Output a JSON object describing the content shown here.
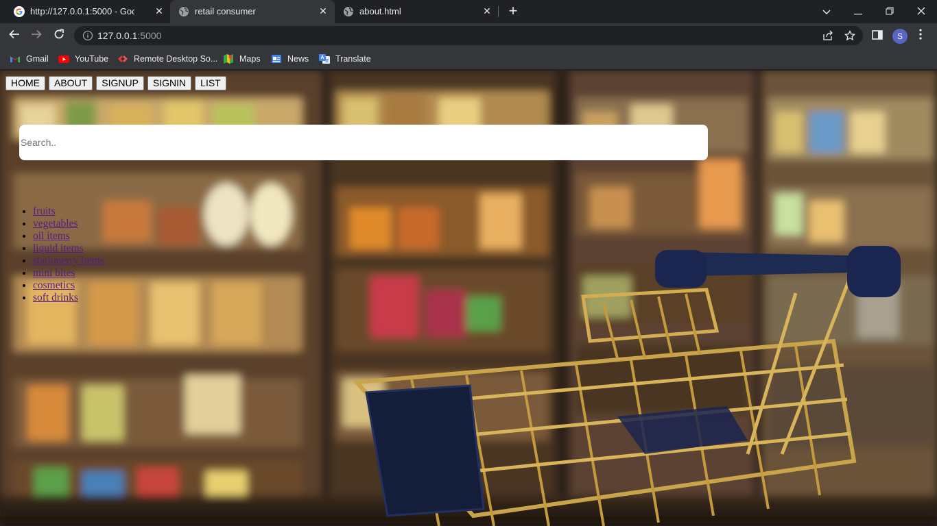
{
  "browser": {
    "tabs": [
      {
        "title": "http://127.0.0.1:5000 - Google Se",
        "icon": "google-g-icon",
        "active": false
      },
      {
        "title": "retail consumer",
        "icon": "globe-icon",
        "active": true
      },
      {
        "title": "about.html",
        "icon": "globe-icon",
        "active": false
      }
    ],
    "new_tab_glyph": "+",
    "url_host": "127.0.0.1",
    "url_port": ":5000",
    "profile_initial": "S",
    "bookmarks": [
      {
        "label": "Gmail",
        "icon": "gmail-icon"
      },
      {
        "label": "YouTube",
        "icon": "youtube-icon"
      },
      {
        "label": "Remote Desktop So...",
        "icon": "remote-desktop-icon"
      },
      {
        "label": "Maps",
        "icon": "maps-icon"
      },
      {
        "label": "News",
        "icon": "news-icon"
      },
      {
        "label": "Translate",
        "icon": "translate-icon"
      }
    ]
  },
  "page": {
    "nav": [
      "HOME",
      "ABOUT",
      "SIGNUP",
      "SIGNIN",
      "LIST"
    ],
    "search_placeholder": "Search..",
    "categories": [
      "fruits",
      "vegetables",
      "oil items",
      "liquid items",
      "stationerry items",
      "mini bites",
      "cosmetics",
      "soft drinks"
    ],
    "background": "supermarket-aisle-with-shopping-cart-photo"
  },
  "colors": {
    "tabstrip": "#202124",
    "toolbar": "#35363a",
    "link_visited": "#551a8b",
    "profile": "#5865c6"
  }
}
